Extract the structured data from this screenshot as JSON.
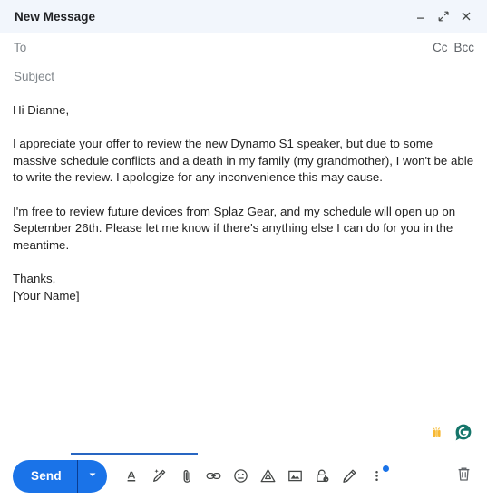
{
  "window": {
    "title": "New Message",
    "controls": [
      {
        "name": "minimize",
        "icon": "minimize-icon"
      },
      {
        "name": "fullscreen",
        "icon": "fullscreen-icon"
      },
      {
        "name": "close",
        "icon": "close-icon"
      }
    ]
  },
  "fields": {
    "to": {
      "label": "To",
      "value": "",
      "placeholder": "To"
    },
    "cc": "Cc",
    "bcc": "Bcc",
    "subject": {
      "label": "Subject",
      "value": "",
      "placeholder": "Subject"
    }
  },
  "body": {
    "text": "Hi Dianne,\n\nI appreciate your offer to review the new Dynamo S1 speaker, but due to some massive schedule conflicts and a death in my family (my grandmother), I won't be able to write the review. I apologize for any inconvenience this may cause.\n\nI'm free to review future devices from Splaz Gear, and my schedule will open up on September 26th. Please let me know if there's anything else I can do for you in the meantime.\n\nThanks,\n[Your Name]",
    "paragraphs": [
      "Hi Dianne,",
      "I appreciate your offer to review the new Dynamo S1 speaker, but due to some massive schedule conflicts and a death in my family (my grandmother), I won't be able to write the review. I apologize for any inconvenience this may cause.",
      "I'm free to review future devices from Splaz Gear, and my schedule will open up on September 26th. Please let me know if there's anything else I can do for you in the meantime.",
      "Thanks,",
      "[Your Name]"
    ]
  },
  "grammarly": {
    "hands_icon": "celebration-hands-icon",
    "logo_icon": "grammarly-logo-icon",
    "logo_color": "#15756a"
  },
  "toolbar": {
    "send_label": "Send",
    "send_color": "#1a73e8",
    "send_dropdown_icon": "chevron-down-icon",
    "icons": [
      {
        "name": "formatting-options-icon",
        "title": "Formatting options"
      },
      {
        "name": "insert-sparkle-pen-icon",
        "title": "Help me write"
      },
      {
        "name": "attach-file-icon",
        "title": "Attach files"
      },
      {
        "name": "insert-link-icon",
        "title": "Insert link"
      },
      {
        "name": "insert-emoji-icon",
        "title": "Insert emoji"
      },
      {
        "name": "insert-drive-icon",
        "title": "Insert files using Drive"
      },
      {
        "name": "insert-photo-icon",
        "title": "Insert photo"
      },
      {
        "name": "confidential-mode-icon",
        "title": "Toggle confidential mode"
      },
      {
        "name": "insert-signature-icon",
        "title": "Insert signature"
      },
      {
        "name": "more-options-icon",
        "title": "More options"
      }
    ],
    "discard": {
      "name": "discard-draft-icon",
      "title": "Discard draft"
    },
    "notification_dot_color": "#1a73e8"
  }
}
